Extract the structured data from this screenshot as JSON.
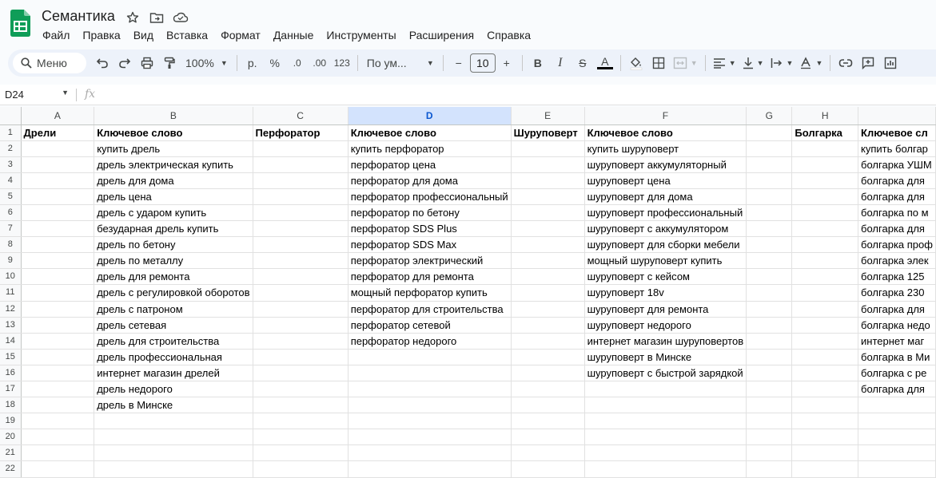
{
  "title_bar": {
    "doc_title": "Семантика",
    "icons": [
      "star-icon",
      "move-folder-icon",
      "cloud-status-icon"
    ]
  },
  "menu": [
    "Файл",
    "Правка",
    "Вид",
    "Вставка",
    "Формат",
    "Данные",
    "Инструменты",
    "Расширения",
    "Справка"
  ],
  "toolbar": {
    "search_label": "Меню",
    "zoom": "100%",
    "currency": "р.",
    "percent": "%",
    "dec_decrease": ".0",
    "dec_increase": ".00",
    "number_format": "123",
    "font_family": "По ум...",
    "font_size": "10",
    "minus": "−",
    "plus": "+",
    "bold": "B",
    "italic": "I",
    "strike": "S",
    "text_color": "A",
    "accent_color": "#000000"
  },
  "formula_bar": {
    "cell_ref": "D24",
    "fx": "fx",
    "content": ""
  },
  "grid": {
    "columns": [
      "A",
      "B",
      "C",
      "D",
      "E",
      "F",
      "G",
      "H",
      ""
    ],
    "selected_column": "D",
    "row_numbers": [
      "1",
      "2",
      "3",
      "4",
      "5",
      "6",
      "7",
      "8",
      "9",
      "10",
      "11",
      "12",
      "13",
      "14",
      "15",
      "16",
      "17",
      "18",
      "19",
      "20",
      "21",
      "22"
    ],
    "rows": [
      [
        "Дрели",
        "Ключевое слово",
        "Перфоратор",
        "Ключевое слово",
        "Шуруповерт",
        "Ключевое слово",
        "",
        "Болгарка",
        "Ключевое сл"
      ],
      [
        "",
        "купить дрель",
        "",
        "купить перфоратор",
        "",
        "купить шуруповерт",
        "",
        "",
        "купить болгар"
      ],
      [
        "",
        "дрель электрическая купить",
        "",
        "перфоратор цена",
        "",
        "шуруповерт аккумуляторный",
        "",
        "",
        "болгарка УШМ"
      ],
      [
        "",
        "дрель для дома",
        "",
        "перфоратор для дома",
        "",
        "шуруповерт цена",
        "",
        "",
        "болгарка для"
      ],
      [
        "",
        "дрель цена",
        "",
        "перфоратор профессиональный",
        "",
        "шуруповерт для дома",
        "",
        "",
        "болгарка для"
      ],
      [
        "",
        "дрель с ударом купить",
        "",
        "перфоратор по бетону",
        "",
        "шуруповерт профессиональный",
        "",
        "",
        "болгарка по м"
      ],
      [
        "",
        "безударная дрель купить",
        "",
        "перфоратор SDS Plus",
        "",
        "шуруповерт с аккумулятором",
        "",
        "",
        "болгарка для"
      ],
      [
        "",
        "дрель по бетону",
        "",
        "перфоратор SDS Max",
        "",
        "шуруповерт для сборки мебели",
        "",
        "",
        "болгарка проф"
      ],
      [
        "",
        "дрель по металлу",
        "",
        "перфоратор электрический",
        "",
        "мощный шуруповерт купить",
        "",
        "",
        "болгарка элек"
      ],
      [
        "",
        "дрель для ремонта",
        "",
        "перфоратор для ремонта",
        "",
        "шуруповерт с кейсом",
        "",
        "",
        "болгарка 125"
      ],
      [
        "",
        "дрель с регулировкой оборотов",
        "",
        "мощный перфоратор купить",
        "",
        "шуруповерт 18v",
        "",
        "",
        "болгарка 230"
      ],
      [
        "",
        "дрель с патроном",
        "",
        "перфоратор для строительства",
        "",
        "шуруповерт для ремонта",
        "",
        "",
        "болгарка для"
      ],
      [
        "",
        "дрель сетевая",
        "",
        "перфоратор сетевой",
        "",
        "шуруповерт недорого",
        "",
        "",
        "болгарка недо"
      ],
      [
        "",
        "дрель для строительства",
        "",
        "перфоратор недорого",
        "",
        "интернет магазин шуруповертов",
        "",
        "",
        "интернет маг"
      ],
      [
        "",
        "дрель профессиональная",
        "",
        "",
        "",
        "шуруповерт в Минске",
        "",
        "",
        "болгарка в Ми"
      ],
      [
        "",
        "интернет магазин дрелей",
        "",
        "",
        "",
        "шуруповерт с быстрой зарядкой",
        "",
        "",
        "болгарка с ре"
      ],
      [
        "",
        "дрель недорого",
        "",
        "",
        "",
        "",
        "",
        "",
        "болгарка для"
      ],
      [
        "",
        "дрель в Минске",
        "",
        "",
        "",
        "",
        "",
        "",
        ""
      ],
      [
        "",
        "",
        "",
        "",
        "",
        "",
        "",
        "",
        ""
      ],
      [
        "",
        "",
        "",
        "",
        "",
        "",
        "",
        "",
        ""
      ],
      [
        "",
        "",
        "",
        "",
        "",
        "",
        "",
        "",
        ""
      ],
      [
        "",
        "",
        "",
        "",
        "",
        "",
        "",
        "",
        ""
      ]
    ]
  }
}
